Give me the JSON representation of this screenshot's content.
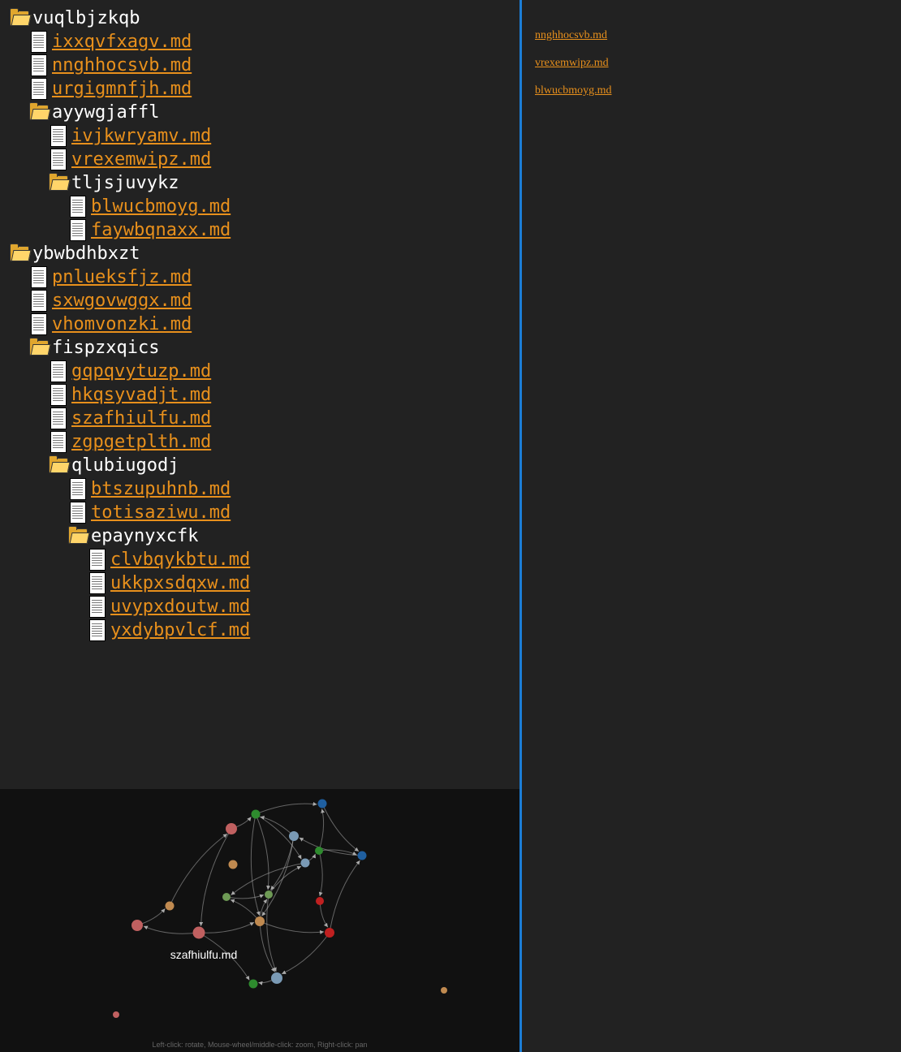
{
  "tree": [
    {
      "type": "folder",
      "name": "vuqlbjzkqb",
      "depth": 0
    },
    {
      "type": "file",
      "name": "ixxqvfxagv.md",
      "depth": 1
    },
    {
      "type": "file",
      "name": "nnghhocsvb.md",
      "depth": 1
    },
    {
      "type": "file",
      "name": "urgigmnfjh.md",
      "depth": 1
    },
    {
      "type": "folder",
      "name": "ayywgjaffl",
      "depth": 1
    },
    {
      "type": "file",
      "name": "ivjkwryamv.md",
      "depth": 2
    },
    {
      "type": "file",
      "name": "vrexemwipz.md",
      "depth": 2
    },
    {
      "type": "folder",
      "name": "tljsjuvykz",
      "depth": 2
    },
    {
      "type": "file",
      "name": "blwucbmoyg.md",
      "depth": 3
    },
    {
      "type": "file",
      "name": "faywbqnaxx.md",
      "depth": 3
    },
    {
      "type": "folder",
      "name": "ybwbdhbxzt",
      "depth": 0
    },
    {
      "type": "file",
      "name": "pnlueksfjz.md",
      "depth": 1
    },
    {
      "type": "file",
      "name": "sxwgovwggx.md",
      "depth": 1
    },
    {
      "type": "file",
      "name": "vhomvonzki.md",
      "depth": 1
    },
    {
      "type": "folder",
      "name": "fispzxqics",
      "depth": 1
    },
    {
      "type": "file",
      "name": "gqpqvytuzp.md",
      "depth": 2
    },
    {
      "type": "file",
      "name": "hkqsyvadjt.md",
      "depth": 2
    },
    {
      "type": "file",
      "name": "szafhiulfu.md",
      "depth": 2
    },
    {
      "type": "file",
      "name": "zgpgetplth.md",
      "depth": 2
    },
    {
      "type": "folder",
      "name": "qlubiugodj",
      "depth": 2
    },
    {
      "type": "file",
      "name": "btszupuhnb.md",
      "depth": 3
    },
    {
      "type": "file",
      "name": "totisaziwu.md",
      "depth": 3
    },
    {
      "type": "folder",
      "name": "epaynyxcfk",
      "depth": 3
    },
    {
      "type": "file",
      "name": "clvbqykbtu.md",
      "depth": 4
    },
    {
      "type": "file",
      "name": "ukkpxsdqxw.md",
      "depth": 4
    },
    {
      "type": "file",
      "name": "uvypxdoutw.md",
      "depth": 4
    },
    {
      "type": "file",
      "name": "yxdybpvlcf.md",
      "depth": 4
    }
  ],
  "backlinks": [
    "nnghhocsvb.md",
    "vrexemwipz.md",
    "blwucbmoyg.md"
  ],
  "graph": {
    "hovered_label": "szafhiulfu.md",
    "hint": "Left-click: rotate, Mouse-wheel/middle-click: zoom, Right-click: pan",
    "colors": {
      "background": "#111111",
      "link": "#cccccc",
      "label": "#ffffff"
    },
    "nodes": [
      {
        "id": 0,
        "color": "#2e8b2e"
      },
      {
        "id": 1,
        "color": "#1f5fa0"
      },
      {
        "id": 2,
        "color": "#c06060"
      },
      {
        "id": 3,
        "color": "#7a9ab5"
      },
      {
        "id": 4,
        "color": "#c08a50"
      },
      {
        "id": 5,
        "color": "#2e8b2e"
      },
      {
        "id": 6,
        "color": "#1f5fa0"
      },
      {
        "id": 7,
        "color": "#7a9ab5"
      },
      {
        "id": 8,
        "color": "#c08a50"
      },
      {
        "id": 9,
        "color": "#6e9a55"
      },
      {
        "id": 10,
        "color": "#6e9a55"
      },
      {
        "id": 11,
        "color": "#c02020"
      },
      {
        "id": 12,
        "color": "#c06060"
      },
      {
        "id": 13,
        "color": "#c08a50"
      },
      {
        "id": 14,
        "color": "#c06060"
      },
      {
        "id": 15,
        "color": "#c02020"
      },
      {
        "id": 16,
        "color": "#2e8b2e"
      },
      {
        "id": 17,
        "color": "#7a9ab5"
      },
      {
        "id": 18,
        "color": "#c08a50"
      },
      {
        "id": 19,
        "color": "#c06060"
      }
    ],
    "links": [
      [
        2,
        0
      ],
      [
        0,
        1
      ],
      [
        1,
        6
      ],
      [
        6,
        3
      ],
      [
        3,
        0
      ],
      [
        0,
        7
      ],
      [
        7,
        5
      ],
      [
        5,
        6
      ],
      [
        5,
        1
      ],
      [
        5,
        11
      ],
      [
        11,
        15
      ],
      [
        15,
        6
      ],
      [
        9,
        10
      ],
      [
        10,
        7
      ],
      [
        7,
        9
      ],
      [
        3,
        10
      ],
      [
        2,
        14
      ],
      [
        14,
        12
      ],
      [
        12,
        8
      ],
      [
        8,
        2
      ],
      [
        14,
        13
      ],
      [
        13,
        10
      ],
      [
        10,
        17
      ],
      [
        17,
        16
      ],
      [
        13,
        17
      ],
      [
        15,
        17
      ],
      [
        13,
        15
      ],
      [
        14,
        16
      ],
      [
        0,
        13
      ],
      [
        3,
        13
      ],
      [
        13,
        9
      ],
      [
        0,
        10
      ]
    ]
  }
}
